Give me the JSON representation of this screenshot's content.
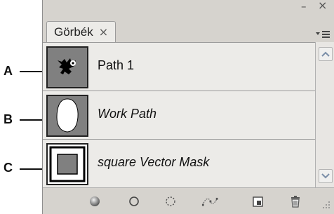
{
  "panel": {
    "title_tab": "Görbék",
    "tab_close_icon": "close-icon",
    "minimize_glyph": "–",
    "close_glyph": "×",
    "tab_close_glyph": "×"
  },
  "callouts": [
    "A",
    "B",
    "C"
  ],
  "paths": [
    {
      "label": "Path 1",
      "italic": false,
      "thumbnail": "bird-silhouette"
    },
    {
      "label": "Work Path",
      "italic": true,
      "thumbnail": "white-oval"
    },
    {
      "label": "square Vector Mask",
      "italic": true,
      "thumbnail": "square-mask"
    }
  ],
  "toolbar": {
    "icons": [
      "fill-path-icon",
      "stroke-path-icon",
      "load-selection-icon",
      "make-work-path-icon",
      "new-path-icon",
      "delete-path-icon"
    ]
  }
}
